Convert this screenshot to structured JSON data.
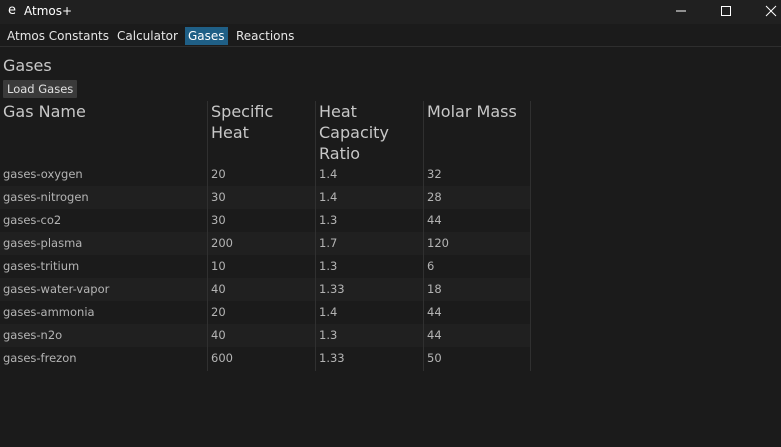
{
  "window": {
    "title": "Atmos+",
    "icon_glyph": "e",
    "icon_name": "app-icon"
  },
  "tabs": [
    {
      "label": "Atmos Constants",
      "active": false
    },
    {
      "label": "Calculator",
      "active": false
    },
    {
      "label": "Gases",
      "active": true
    },
    {
      "label": "Reactions",
      "active": false
    }
  ],
  "page": {
    "title": "Gases",
    "load_button": "Load Gases"
  },
  "table": {
    "headers": [
      [
        "Gas Name"
      ],
      [
        "Specific",
        "Heat"
      ],
      [
        "Heat",
        "Capacity",
        "Ratio"
      ],
      [
        "Molar Mass"
      ]
    ],
    "rows": [
      [
        "gases-oxygen",
        "20",
        "1.4",
        "32"
      ],
      [
        "gases-nitrogen",
        "30",
        "1.4",
        "28"
      ],
      [
        "gases-co2",
        "30",
        "1.3",
        "44"
      ],
      [
        "gases-plasma",
        "200",
        "1.7",
        "120"
      ],
      [
        "gases-tritium",
        "10",
        "1.3",
        "6"
      ],
      [
        "gases-water-vapor",
        "40",
        "1.33",
        "18"
      ],
      [
        "gases-ammonia",
        "20",
        "1.4",
        "44"
      ],
      [
        "gases-n2o",
        "40",
        "1.3",
        "44"
      ],
      [
        "gases-frezon",
        "600",
        "1.33",
        "50"
      ]
    ]
  },
  "colors": {
    "background": "#1b1b1b",
    "active_tab": "#1f5f86",
    "button": "#3a3a3a"
  }
}
